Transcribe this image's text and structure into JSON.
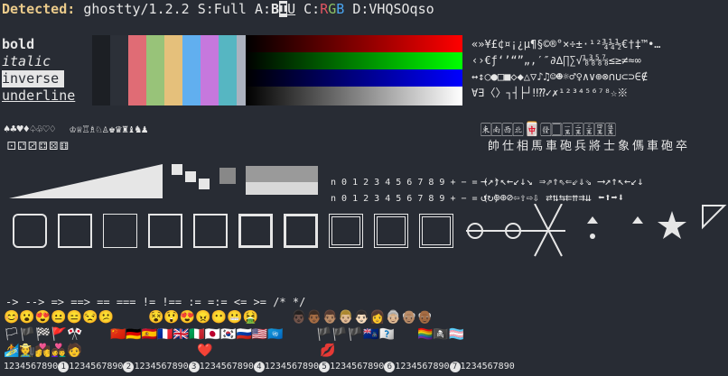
{
  "header": {
    "label": "Detected:",
    "terminal": "ghostty/1.2.2",
    "support_prefix": "S:Full A:",
    "attr_b": "B",
    "attr_i": "I",
    "attr_inv": "I",
    "attr_u": "U",
    "color_prefix": "C:",
    "r": "R",
    "g": "G",
    "bl": "B",
    "dims": "D:VHQSOqso"
  },
  "styles": {
    "bold": "bold",
    "italic": "italic",
    "inverse": "inverse",
    "underline": "underline"
  },
  "palette": [
    "#1c1f24",
    "#2c3038",
    "#e06c75",
    "#98c379",
    "#e5c07b",
    "#61afef",
    "#c678dd",
    "#56b6c2",
    "#abb2bf",
    "#5c6370"
  ],
  "symbols": {
    "row1": "«»¥£¢¤¡¿µ¶§©®°×÷±·¹²¾¼½€†‡™•…",
    "row2": "‹›€ƒ‘’“”„‚′″∂∆∏∑√⅛⅜⅝⅞≤≥≠≈∞",
    "row3": "↔↕○●□■◇◆△▽♪♫☺☻☼♂♀∧∨⊕⊗∩∪⊂⊃∈∉",
    "row4": "∀∃〈〉┐┤├┘‼⁇✓✗¹²³⁴⁵⁶⁷⁸☆※"
  },
  "games": {
    "cards": "♠♣♥♦♤♧♡♢",
    "chess": "♔♕♖♗♘♙♚♛♜♝♞♟",
    "dice": "⚀⚁⚂⚃⚄⚅",
    "mahjong": "🀀🀁🀂🀃🀄🀅🀆🀇🀈🀉🀊🀋",
    "xiangqi": "帥仕相馬車砲兵將士象傌車砲卒"
  },
  "digits": {
    "row": "n 0 1 2 3 4 5 6 7 8 9 + − = ( )",
    "row2": "n 0 1 2 3 4 5 6 7 8 9 + − = ( )"
  },
  "arrows": {
    "row1": "→↗↑↖←↙↓↘  ⇒⇗⇑⇖⇐⇙⇓⇘  ⟶↗↑↖←↙↓",
    "row2": "↺↻⊖⊕⊘⇦⇧⇨⇩  ⇄⇅⇆⇇⇈⇉⇊  ⬅⬆➡⬇"
  },
  "ligatures": "-> --> => ==> == === != !== := =:= <= >= /* */",
  "ruler": "1234567890",
  "faces": "😊😮😍😐😑😒😕",
  "faces2": "😵😲😍😠😶😬🤮",
  "people": "👨🏿👨🏾👨🏽👨🏼👨🏻👩👵🏼👴🏽👴🏾",
  "flags_row1": "🏳🏴🏁🚩🎌",
  "flags_row2": "🇨🇳🇩🇪🇪🇸🇫🇷🇬🇧🇮🇹🇯🇵🇰🇷🇷🇺🇺🇸🇺🇳",
  "flags_row3": "🏴🏴🏴🇦🇨🇺🇺",
  "misc_row": "🏄🧑‍🌾💏👩‍❤️‍👨🧑",
  "heart": "❤️",
  "lips": "💋",
  "rainbow": "🏳️‍🌈🏴‍☠️🏳️‍⚧️"
}
